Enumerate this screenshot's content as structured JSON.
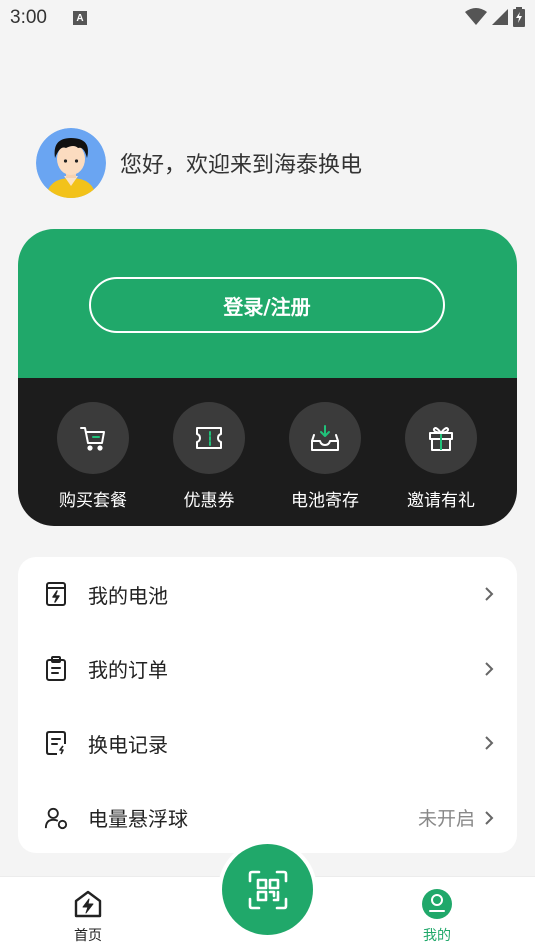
{
  "status_bar": {
    "time": "3:00",
    "a_badge": "A"
  },
  "profile": {
    "greeting": "您好，欢迎来到海泰换电",
    "avatar_icon": "avatar-icon"
  },
  "login": {
    "label": "登录/注册"
  },
  "quick_actions": [
    {
      "label": "购买套餐",
      "icon": "cart-icon"
    },
    {
      "label": "优惠券",
      "icon": "coupon-icon"
    },
    {
      "label": "电池寄存",
      "icon": "battery-storage-icon"
    },
    {
      "label": "邀请有礼",
      "icon": "gift-icon"
    }
  ],
  "menu": [
    {
      "label": "我的电池",
      "icon": "battery-icon",
      "status": ""
    },
    {
      "label": "我的订单",
      "icon": "order-clipboard-icon",
      "status": ""
    },
    {
      "label": "换电记录",
      "icon": "record-icon",
      "status": ""
    },
    {
      "label": "电量悬浮球",
      "icon": "floating-ball-icon",
      "status": "未开启"
    }
  ],
  "nav": {
    "home": "首页",
    "mine": "我的"
  },
  "colors": {
    "accent": "#20a86a",
    "dark_panel": "#1c1c1c",
    "background": "#f4f4f4"
  }
}
